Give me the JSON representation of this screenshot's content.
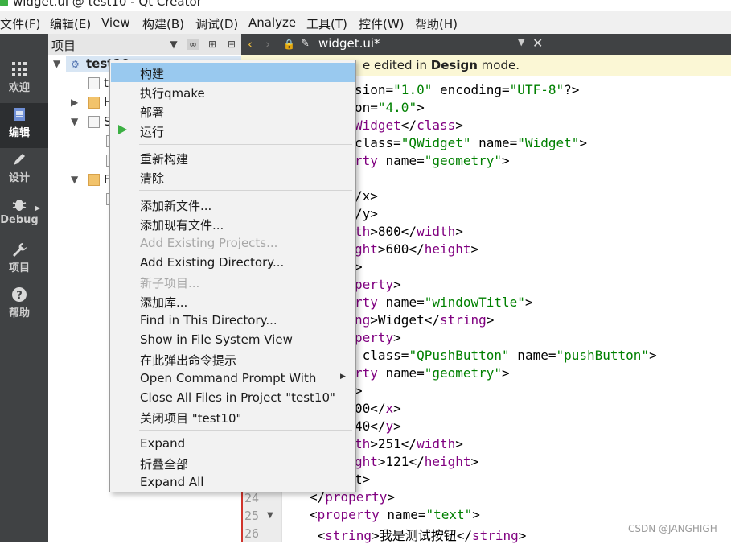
{
  "window": {
    "title": "widget.ui @ test10 - Qt Creator"
  },
  "menubar": [
    "文件(F)",
    "编辑(E)",
    "View",
    "构建(B)",
    "调试(D)",
    "Analyze",
    "工具(T)",
    "控件(W)",
    "帮助(H)"
  ],
  "modes": [
    {
      "label": "欢迎",
      "icon": "grid-icon"
    },
    {
      "label": "编辑",
      "icon": "document-icon"
    },
    {
      "label": "设计",
      "icon": "pencil-icon"
    },
    {
      "label": "Debug",
      "icon": "bug-icon"
    },
    {
      "label": "项目",
      "icon": "wrench-icon"
    },
    {
      "label": "帮助",
      "icon": "question-icon"
    }
  ],
  "project_pane": {
    "title": "项目",
    "tree": {
      "root": "test10",
      "child1": "te",
      "child2": "H",
      "child3": "S",
      "child4": "F"
    }
  },
  "editor": {
    "filename": "widget.ui*",
    "info_prefix": "e edited in ",
    "info_bold": "Design",
    "info_suffix": " mode.",
    "line_numbers": [
      "24",
      "25",
      "26"
    ],
    "lines": [
      "sion=\"1.0\" encoding=\"UTF-8\"?>",
      "on=\"4.0\">",
      "Widget</class>",
      "class=\"QWidget\" name=\"Widget\">",
      "rty name=\"geometry\">",
      "",
      "/x>",
      "/y>",
      "th>800</width>",
      "ght>600</height>",
      ">",
      "perty>",
      "rty name=\"windowTitle\">",
      "ng>Widget</string>",
      "perty>",
      " class=\"QPushButton\" name=\"pushButton\">",
      "rty name=\"geometry\">",
      ">",
      "00</x>",
      "40</y>",
      "th>251</width>",
      "ght>121</height>",
      "t>",
      "</property>",
      "<property name=\"text\">",
      " <string>我是测试按钮</string>"
    ]
  },
  "context_menu": {
    "items": [
      {
        "label": "构建",
        "state": "highlighted"
      },
      {
        "label": "执行qmake",
        "state": "normal"
      },
      {
        "label": "部署",
        "state": "normal"
      },
      {
        "label": "运行",
        "state": "normal",
        "icon": "run-icon"
      },
      {
        "label": "重新构建",
        "state": "normal"
      },
      {
        "label": "清除",
        "state": "normal"
      },
      {
        "label": "添加新文件...",
        "state": "normal"
      },
      {
        "label": "添加现有文件...",
        "state": "normal"
      },
      {
        "label": "Add Existing Projects...",
        "state": "disabled"
      },
      {
        "label": "Add Existing Directory...",
        "state": "normal"
      },
      {
        "label": "新子项目...",
        "state": "disabled"
      },
      {
        "label": "添加库...",
        "state": "normal"
      },
      {
        "label": "Find in This Directory...",
        "state": "normal"
      },
      {
        "label": "Show in File System View",
        "state": "normal"
      },
      {
        "label": "在此弹出命令提示",
        "state": "normal"
      },
      {
        "label": "Open Command Prompt With",
        "state": "normal",
        "submenu": true
      },
      {
        "label": "Close All Files in Project \"test10\"",
        "state": "normal"
      },
      {
        "label": "关闭项目 \"test10\"",
        "state": "normal"
      },
      {
        "label": "Expand",
        "state": "normal"
      },
      {
        "label": "折叠全部",
        "state": "normal"
      },
      {
        "label": "Expand All",
        "state": "normal"
      }
    ]
  },
  "watermark": "CSDN @JANGHIGH"
}
